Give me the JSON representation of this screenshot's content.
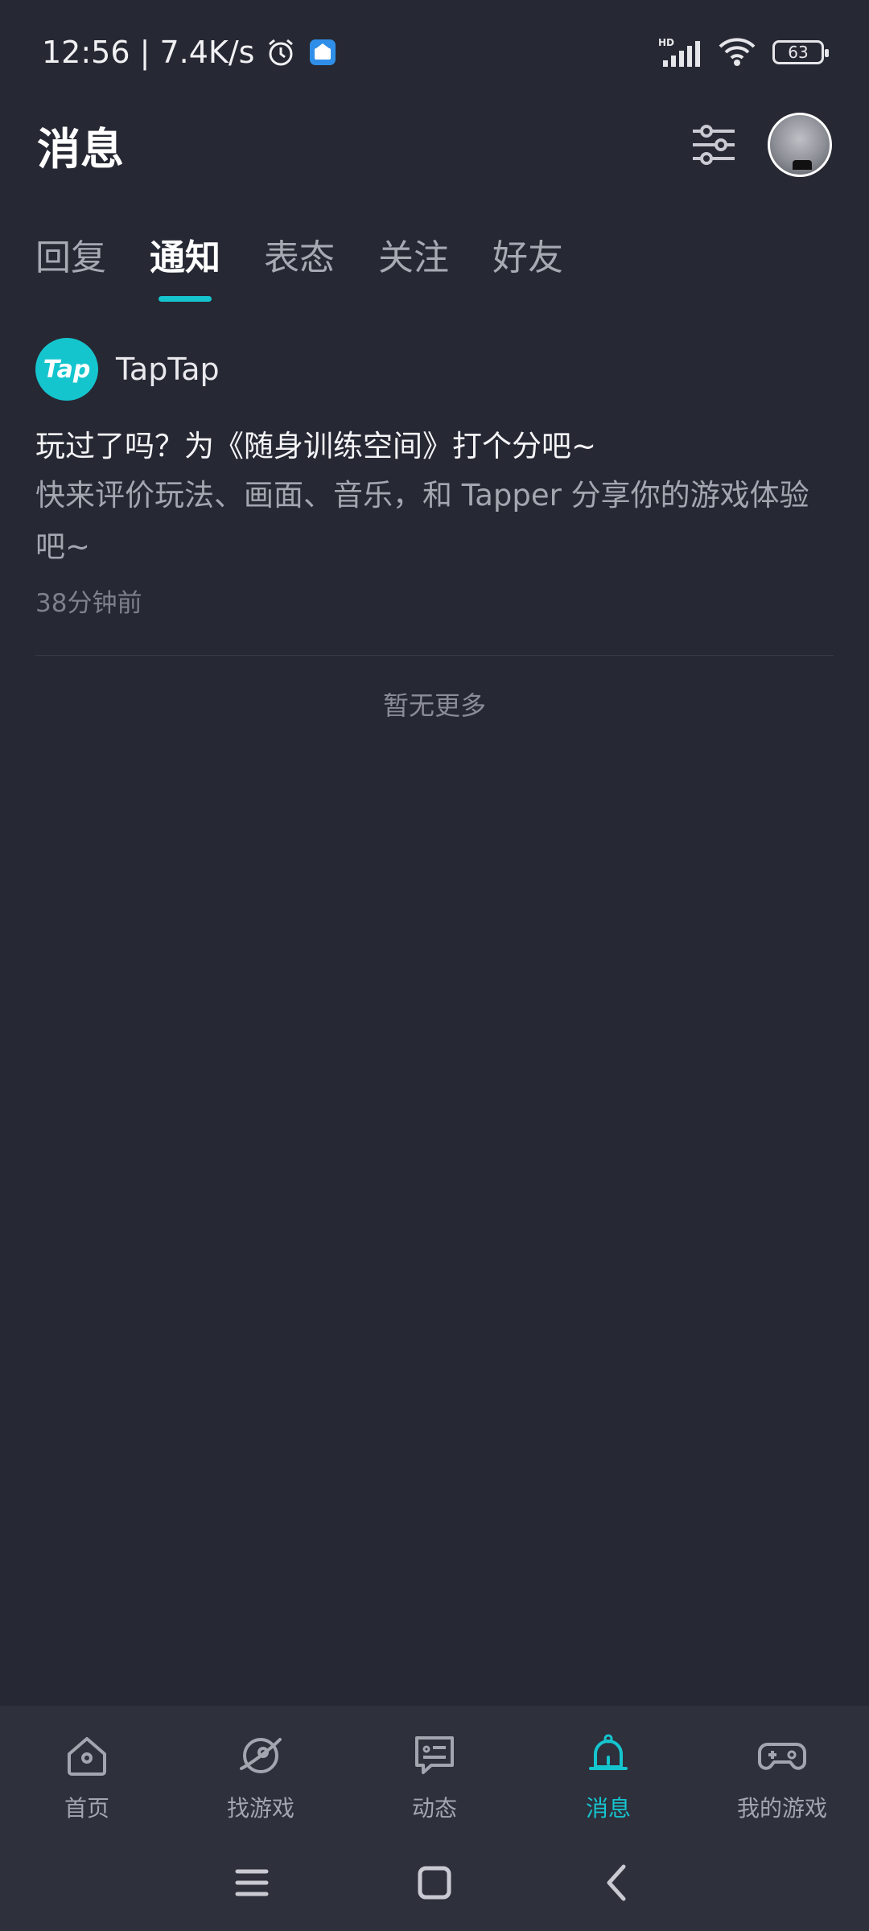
{
  "status_bar": {
    "time_speed": "12:56 | 7.4K/s",
    "network_label": "HD",
    "battery": "63"
  },
  "header": {
    "title": "消息"
  },
  "tabs": [
    {
      "label": "回复",
      "active": false
    },
    {
      "label": "通知",
      "active": true
    },
    {
      "label": "表态",
      "active": false
    },
    {
      "label": "关注",
      "active": false
    },
    {
      "label": "好友",
      "active": false
    }
  ],
  "notification": {
    "logo_text": "Tap",
    "sender": "TapTap",
    "title": "玩过了吗？为《随身训练空间》打个分吧~",
    "body": "快来评价玩法、画面、音乐，和 Tapper 分享你的游戏体验吧~",
    "time": "38分钟前"
  },
  "footer_text": "暂无更多",
  "bottom_nav": [
    {
      "label": "首页",
      "icon": "home-icon"
    },
    {
      "label": "找游戏",
      "icon": "planet-icon"
    },
    {
      "label": "动态",
      "icon": "chat-icon"
    },
    {
      "label": "消息",
      "icon": "bell-icon",
      "active": true
    },
    {
      "label": "我的游戏",
      "icon": "gamepad-icon"
    }
  ],
  "colors": {
    "background": "#262833",
    "accent": "#15c5ce",
    "nav_background": "#2e303c"
  }
}
